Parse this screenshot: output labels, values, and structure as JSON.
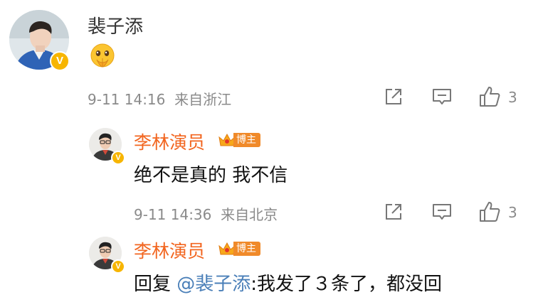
{
  "comment": {
    "author": "裴子添",
    "emoji": "pleading-hands-emoji",
    "timestamp": "9-11 14:16",
    "location": "来自浙江",
    "like_count": "3"
  },
  "replies": [
    {
      "author": "李林演员",
      "badge_label": "博主",
      "text": "绝不是真的 我不信",
      "timestamp": "9-11 14:36",
      "location": "来自北京",
      "like_count": "3"
    },
    {
      "author": "李林演员",
      "badge_label": "博主",
      "reply_prefix": "回复 ",
      "mention": "@裴子添",
      "text": ":我发了３条了，都没回"
    }
  ],
  "colors": {
    "name_orange": "#f2651f",
    "mention_blue": "#4a7fb8",
    "meta_gray": "#8a8a8a",
    "verified_gold": "#f7b500",
    "badge_orange": "#f08a2a"
  }
}
